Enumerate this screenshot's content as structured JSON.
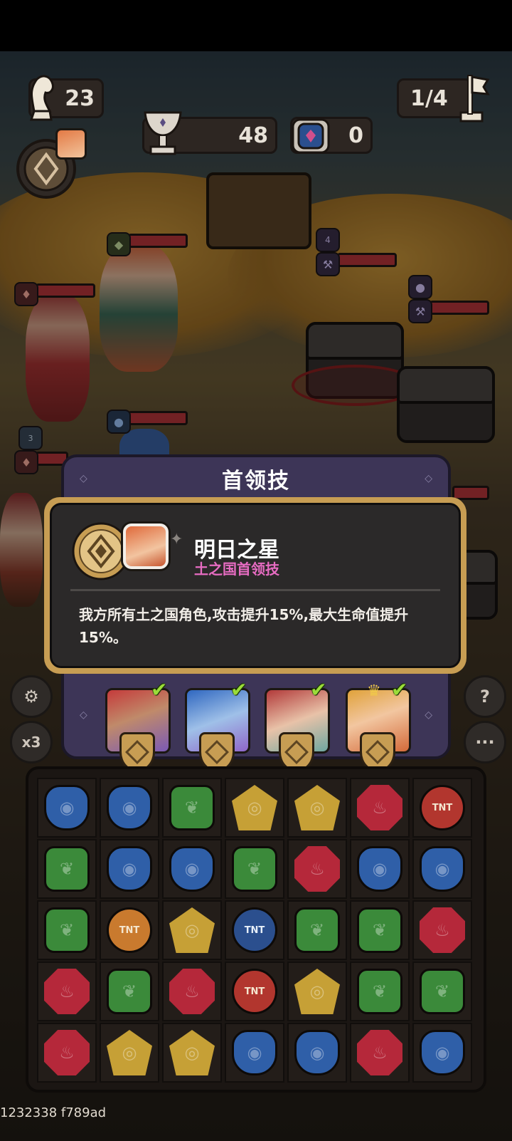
{
  "hud": {
    "moves": "23",
    "wave": "1/4",
    "trophy_score": "48",
    "chest_count": "0"
  },
  "dialog": {
    "title": "首领技",
    "skill_name": "明日之星",
    "skill_subtitle": "土之国首领技",
    "skill_description": "我方所有土之国角色,攻击提升15%,最大生命值提升15%。"
  },
  "left_buttons": {
    "speed": "x3"
  },
  "right_buttons": {
    "help": "?",
    "more": "···"
  },
  "enemy_badges": [
    {
      "count": "4"
    }
  ],
  "ally_badge": {
    "count": "3"
  },
  "board": {
    "rows": [
      [
        "blue",
        "blue",
        "green",
        "yellow",
        "yellow",
        "red",
        "tnt-red"
      ],
      [
        "green",
        "blue",
        "blue",
        "green",
        "red",
        "blue",
        "blue"
      ],
      [
        "green",
        "tnt-orange",
        "yellow",
        "tnt-blue",
        "green",
        "green",
        "red"
      ],
      [
        "red",
        "green",
        "red",
        "tnt-red",
        "yellow",
        "green",
        "green"
      ],
      [
        "red",
        "yellow",
        "yellow",
        "blue",
        "blue",
        "red",
        "blue"
      ]
    ],
    "tnt_label": "TNT"
  },
  "build_info": "1232338 f789ad",
  "colors": {
    "accent_pink": "#e76cc2",
    "check_green": "#9bdc3a",
    "dialog_purple": "#3d3557",
    "card_gold": "#c79d53"
  }
}
